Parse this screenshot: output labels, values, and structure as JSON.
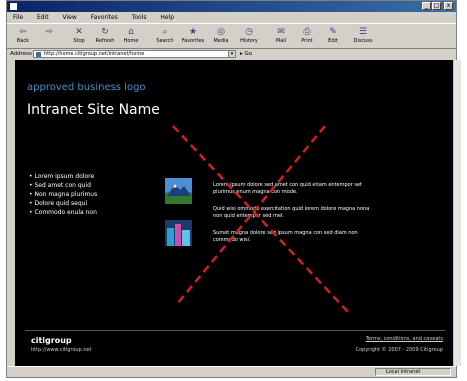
{
  "window": {
    "controls": [
      "_",
      "□",
      "x"
    ]
  },
  "menu": [
    "File",
    "Edit",
    "View",
    "Favorites",
    "Tools",
    "Help"
  ],
  "toolbar": [
    {
      "label": "Back",
      "icon": "back-arrow-icon",
      "glyph": "⇦"
    },
    {
      "label": "",
      "icon": "forward-arrow-icon",
      "glyph": "⇨"
    },
    {
      "label": "Stop",
      "icon": "stop-icon",
      "glyph": "✕"
    },
    {
      "label": "Refresh",
      "icon": "refresh-icon",
      "glyph": "↻"
    },
    {
      "label": "Home",
      "icon": "home-icon",
      "glyph": "⌂"
    },
    {
      "label": "Search",
      "icon": "search-icon",
      "glyph": "⌕"
    },
    {
      "label": "Favorites",
      "icon": "favorites-icon",
      "glyph": "★"
    },
    {
      "label": "Media",
      "icon": "media-icon",
      "glyph": "◎"
    },
    {
      "label": "History",
      "icon": "history-icon",
      "glyph": "◷"
    },
    {
      "label": "Mail",
      "icon": "mail-icon",
      "glyph": "✉"
    },
    {
      "label": "Print",
      "icon": "print-icon",
      "glyph": "⎙"
    },
    {
      "label": "Edit",
      "icon": "edit-icon",
      "glyph": "✎"
    },
    {
      "label": "Discuss",
      "icon": "discuss-icon",
      "glyph": "☰"
    }
  ],
  "address": {
    "label": "Address",
    "value": "http://home.citigroup.net/intranet/home",
    "go_label": "Go"
  },
  "page": {
    "logo_text": "approved business logo",
    "site_name": "Intranet Site Name",
    "nav": [
      "Lorem ipsum dolore",
      "Sed amet con quid",
      "Non magna plurimus",
      "Dolore quid sequi",
      "Commodo enula non"
    ],
    "paragraphs": [
      "Lorem ipsum dolore sed amet con quid etiam entempor set plurimus enum magna con mode.",
      "Quid wisi ommodo exercitation quid lorem dolore magna nona non quid entempor sed mel.",
      "Sumet magna dolore sed ipsum magna con sed diam non commodo wisi."
    ],
    "footer_logo": "citigroup",
    "footer_url": "http://www.citigroup.net",
    "footer_links": "Terms, conditions, and caveats",
    "footer_copy": "Copyright © 2007 - 2009 Citigroup"
  },
  "status": {
    "zone": "Local intranet"
  },
  "colors": {
    "cross": "#cc2222",
    "logo": "#4a90c8"
  }
}
